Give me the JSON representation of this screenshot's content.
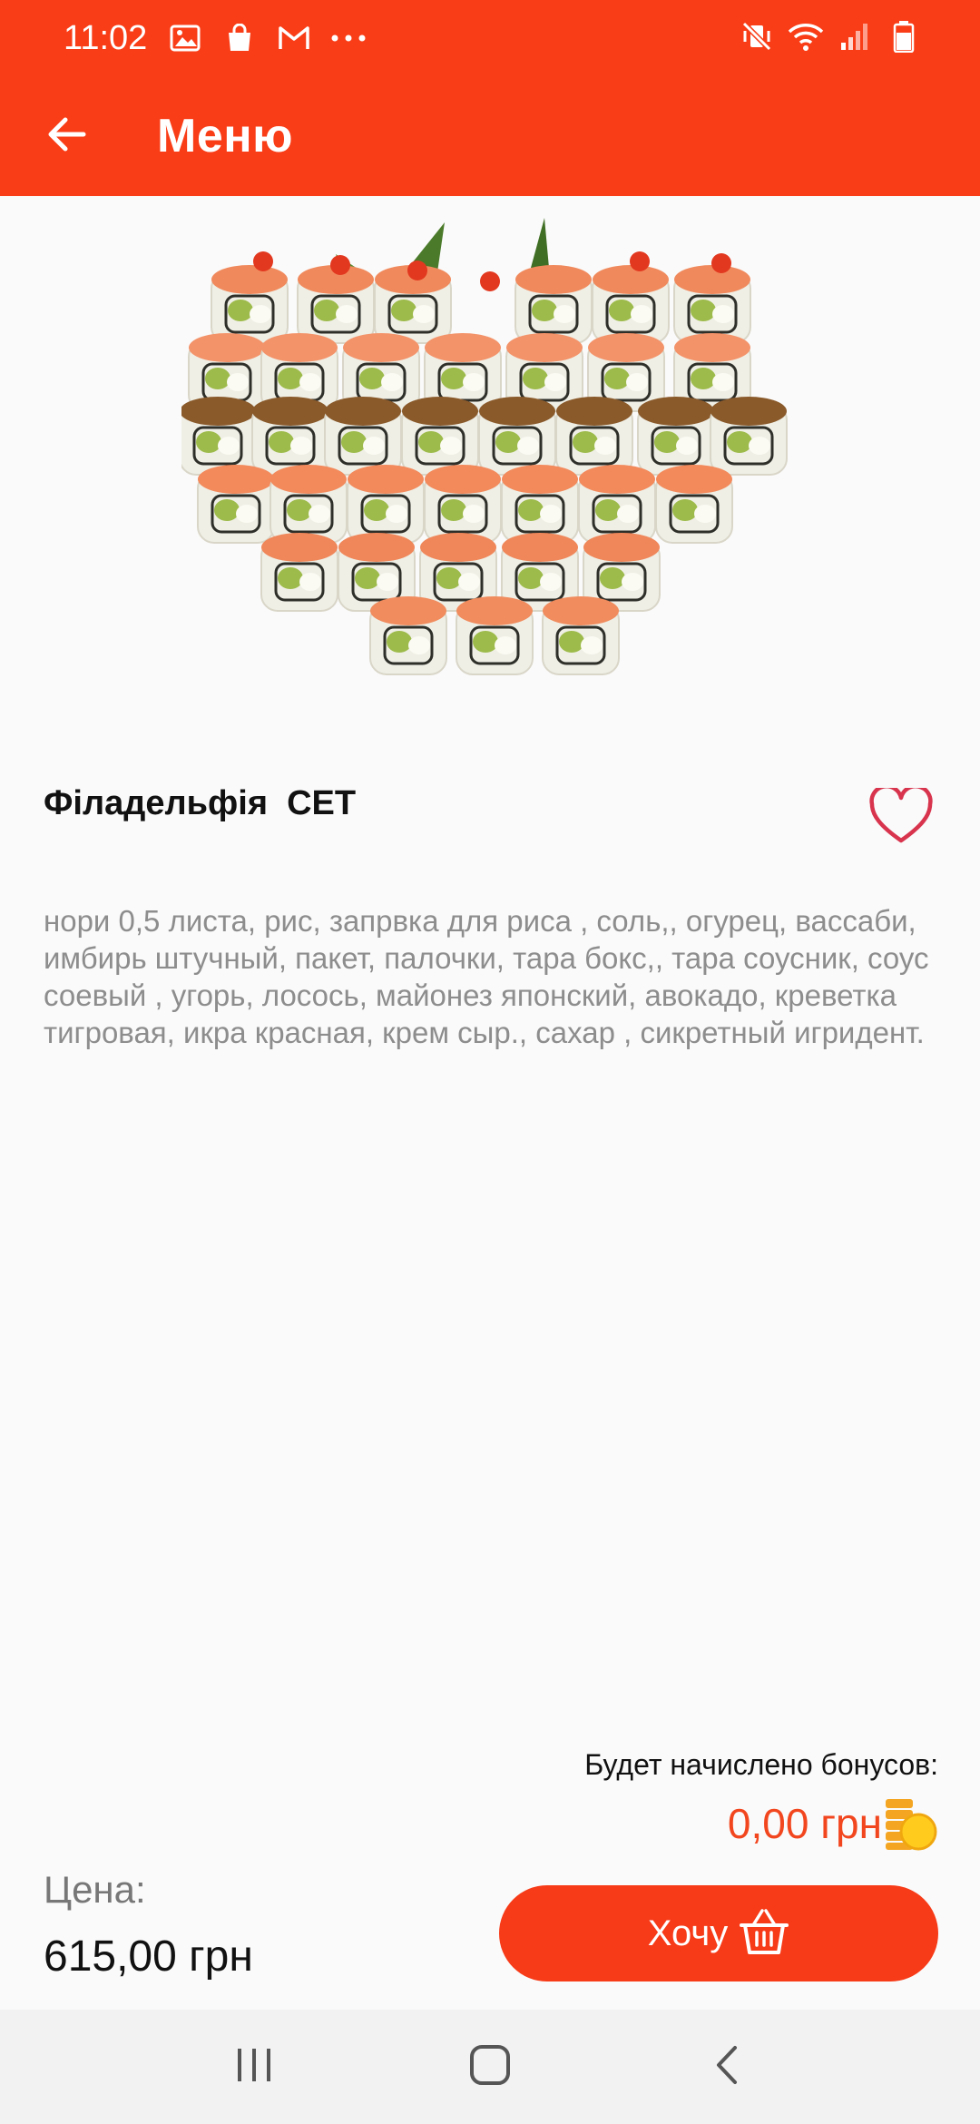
{
  "status_bar": {
    "time": "11:02",
    "left_icons": [
      "image-icon",
      "shopping-bag-icon",
      "gmail-icon",
      "more-dots-icon"
    ],
    "right_icons": [
      "mute-vibrate-icon",
      "wifi-icon",
      "signal-icon",
      "battery-icon"
    ]
  },
  "app_bar": {
    "title": "Меню",
    "back_icon": "arrow-left-icon",
    "background": "#f93d17"
  },
  "product": {
    "name": "Філадельфія  СЕТ",
    "description": "нори 0,5 листа, рис, запрвка для риса , соль,, огурец, вассаби, имбирь штучный, пакет, палочки, тара бокс,, тара соусник, соус соевый , угорь, лосось, майонез японский, авокадо, креветка тигровая, икра красная, крем сыр., сахар , сикретный игридент.",
    "image_icon": "sushi-set-image",
    "favorite_icon": "heart-outline-icon"
  },
  "bonus": {
    "label": "Будет начислено бонусов:",
    "value": "0,00 грн",
    "icon": "coins-icon"
  },
  "price": {
    "label": "Цена:",
    "value": "615,00 грн"
  },
  "want_button": {
    "label": "Хочу",
    "icon": "basket-icon"
  },
  "nav_bar": {
    "items": [
      "recents-icon",
      "home-icon",
      "back-icon"
    ]
  },
  "colors": {
    "accent": "#f93d17",
    "bonus_text": "#f2461e",
    "description_text": "#8d8d8d",
    "heart": "#d8344e"
  }
}
